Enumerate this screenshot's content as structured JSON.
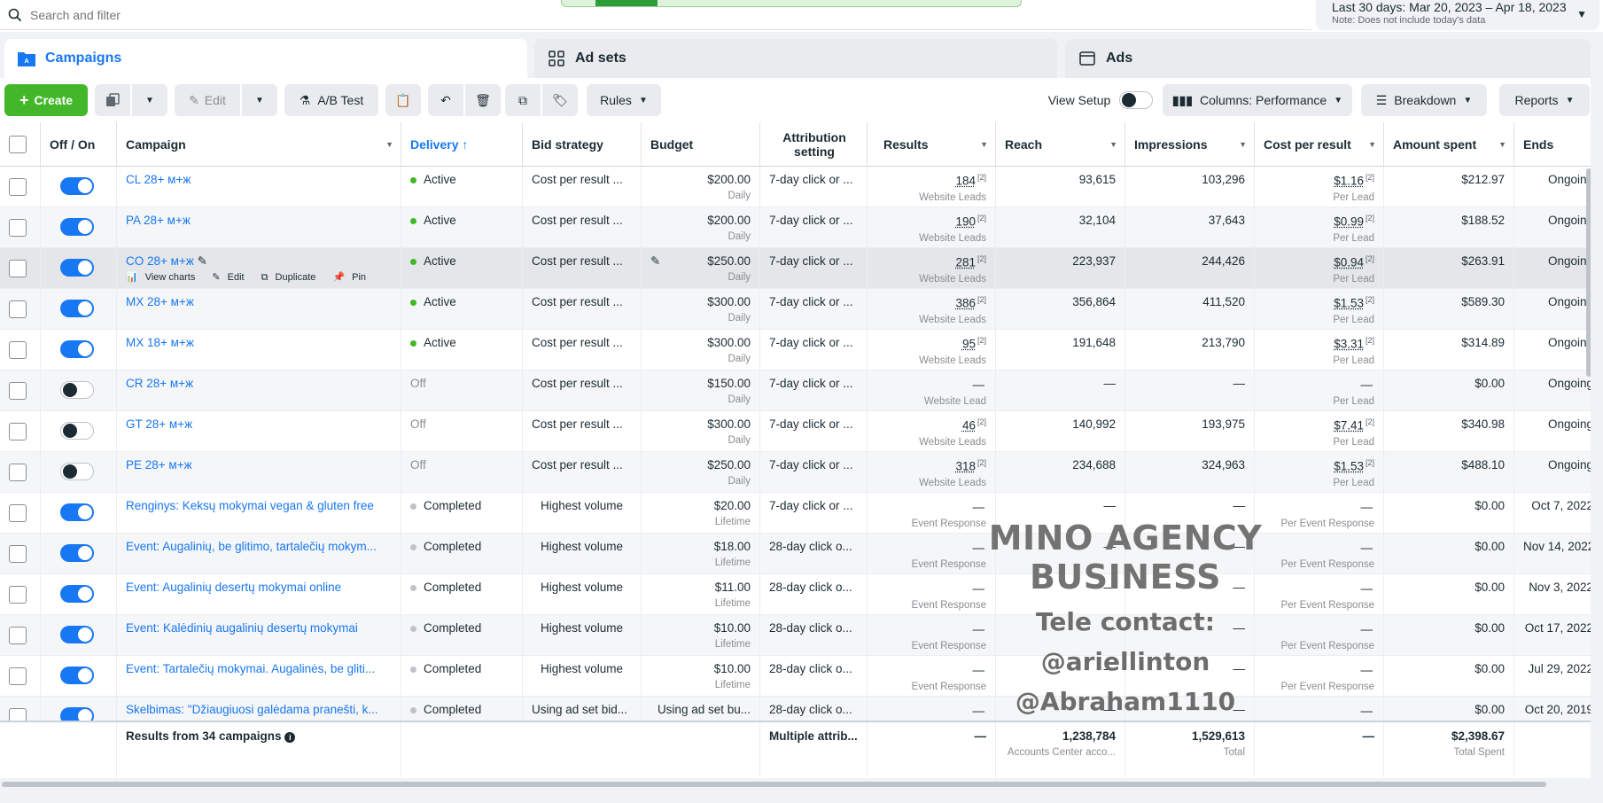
{
  "search": {
    "placeholder": "Search and filter"
  },
  "date_range": {
    "label": "Last 30 days: Mar 20, 2023 – Apr 18, 2023",
    "note": "Note: Does not include today's data"
  },
  "tabs": [
    {
      "label": "Campaigns",
      "icon": "folder-icon",
      "active": true
    },
    {
      "label": "Ad sets",
      "icon": "grid-icon",
      "active": false
    },
    {
      "label": "Ads",
      "icon": "ad-icon",
      "active": false
    }
  ],
  "toolbar": {
    "create": "Create",
    "edit": "Edit",
    "ab_test": "A/B Test",
    "rules": "Rules",
    "view_setup": "View Setup",
    "columns": "Columns: Performance",
    "breakdown": "Breakdown",
    "reports": "Reports"
  },
  "columns": [
    "Off / On",
    "Campaign",
    "Delivery ↑",
    "Bid strategy",
    "Budget",
    "Attribution setting",
    "Results",
    "Reach",
    "Impressions",
    "Cost per result",
    "Amount spent",
    "Ends"
  ],
  "hover_actions": {
    "view_charts": "View charts",
    "edit": "Edit",
    "duplicate": "Duplicate",
    "pin": "Pin"
  },
  "rows": [
    {
      "on": true,
      "campaign": "CL 28+ м+ж",
      "delivery": "Active",
      "status": "active",
      "bid": "Cost per result ...",
      "budget": "$200.00",
      "budget_type": "Daily",
      "attribution": "7-day click or ...",
      "results": "184",
      "results_badge": "[2]",
      "results_sub": "Website Leads",
      "reach": "93,615",
      "impressions": "103,296",
      "cpr": "$1.16",
      "cpr_badge": "[2]",
      "cpr_sub": "Per Lead",
      "spent": "$212.97",
      "ends": "Ongoing"
    },
    {
      "on": true,
      "campaign": "PA 28+ м+ж",
      "delivery": "Active",
      "status": "active",
      "bid": "Cost per result ...",
      "budget": "$200.00",
      "budget_type": "Daily",
      "attribution": "7-day click or ...",
      "results": "190",
      "results_badge": "[2]",
      "results_sub": "Website Leads",
      "reach": "32,104",
      "impressions": "37,643",
      "cpr": "$0.99",
      "cpr_badge": "[2]",
      "cpr_sub": "Per Lead",
      "spent": "$188.52",
      "ends": "Ongoing"
    },
    {
      "on": true,
      "campaign": "CO 28+ м+ж",
      "delivery": "Active",
      "status": "active",
      "bid": "Cost per result ...",
      "budget": "$250.00",
      "budget_type": "Daily",
      "attribution": "7-day click or ...",
      "results": "281",
      "results_badge": "[2]",
      "results_sub": "Website Leads",
      "reach": "223,937",
      "impressions": "244,426",
      "cpr": "$0.94",
      "cpr_badge": "[2]",
      "cpr_sub": "Per Lead",
      "spent": "$263.91",
      "ends": "Ongoing",
      "hover": true
    },
    {
      "on": true,
      "campaign": "MX 28+ м+ж",
      "delivery": "Active",
      "status": "active",
      "bid": "Cost per result ...",
      "budget": "$300.00",
      "budget_type": "Daily",
      "attribution": "7-day click or ...",
      "results": "386",
      "results_badge": "[2]",
      "results_sub": "Website Leads",
      "reach": "356,864",
      "impressions": "411,520",
      "cpr": "$1.53",
      "cpr_badge": "[2]",
      "cpr_sub": "Per Lead",
      "spent": "$589.30",
      "ends": "Ongoing"
    },
    {
      "on": true,
      "campaign": "MX 18+ м+ж",
      "delivery": "Active",
      "status": "active",
      "bid": "Cost per result ...",
      "budget": "$300.00",
      "budget_type": "Daily",
      "attribution": "7-day click or ...",
      "results": "95",
      "results_badge": "[2]",
      "results_sub": "Website Leads",
      "reach": "191,648",
      "impressions": "213,790",
      "cpr": "$3.31",
      "cpr_badge": "[2]",
      "cpr_sub": "Per Lead",
      "spent": "$314.89",
      "ends": "Ongoing"
    },
    {
      "on": false,
      "campaign": "CR 28+ м+ж",
      "delivery": "Off",
      "status": "off",
      "bid": "Cost per result ...",
      "budget": "$150.00",
      "budget_type": "Daily",
      "attribution": "7-day click or ...",
      "results": "—",
      "results_badge": "",
      "results_sub": "Website Lead",
      "reach": "—",
      "impressions": "—",
      "cpr": "—",
      "cpr_badge": "",
      "cpr_sub": "Per Lead",
      "spent": "$0.00",
      "ends": "Ongoing"
    },
    {
      "on": false,
      "campaign": "GT 28+ м+ж",
      "delivery": "Off",
      "status": "off",
      "bid": "Cost per result ...",
      "budget": "$300.00",
      "budget_type": "Daily",
      "attribution": "7-day click or ...",
      "results": "46",
      "results_badge": "[2]",
      "results_sub": "Website Leads",
      "reach": "140,992",
      "impressions": "193,975",
      "cpr": "$7.41",
      "cpr_badge": "[2]",
      "cpr_sub": "Per Lead",
      "spent": "$340.98",
      "ends": "Ongoing"
    },
    {
      "on": false,
      "campaign": "PE 28+ м+ж",
      "delivery": "Off",
      "status": "off",
      "bid": "Cost per result ...",
      "budget": "$250.00",
      "budget_type": "Daily",
      "attribution": "7-day click or ...",
      "results": "318",
      "results_badge": "[2]",
      "results_sub": "Website Leads",
      "reach": "234,688",
      "impressions": "324,963",
      "cpr": "$1.53",
      "cpr_badge": "[2]",
      "cpr_sub": "Per Lead",
      "spent": "$488.10",
      "ends": "Ongoing"
    },
    {
      "on": true,
      "campaign": "Renginys: Keksų mokymai vegan & gluten free",
      "delivery": "Completed",
      "status": "completed",
      "bid": "Highest volume",
      "budget": "$20.00",
      "budget_type": "Lifetime",
      "attribution": "7-day click or ...",
      "results": "—",
      "results_badge": "",
      "results_sub": "Event Response",
      "reach": "—",
      "impressions": "—",
      "cpr": "—",
      "cpr_badge": "",
      "cpr_sub": "Per Event Response",
      "spent": "$0.00",
      "ends": "Oct 7, 2022"
    },
    {
      "on": true,
      "campaign": "Event: Augalinių, be glitimo, tartalečių mokym...",
      "delivery": "Completed",
      "status": "completed",
      "bid": "Highest volume",
      "budget": "$18.00",
      "budget_type": "Lifetime",
      "attribution": "28-day click o...",
      "results": "—",
      "results_badge": "",
      "results_sub": "Event Response",
      "reach": "—",
      "impressions": "—",
      "cpr": "—",
      "cpr_badge": "",
      "cpr_sub": "Per Event Response",
      "spent": "$0.00",
      "ends": "Nov 14, 2022"
    },
    {
      "on": true,
      "campaign": "Event: Augalinių desertų mokymai online",
      "delivery": "Completed",
      "status": "completed",
      "bid": "Highest volume",
      "budget": "$11.00",
      "budget_type": "Lifetime",
      "attribution": "28-day click o...",
      "results": "—",
      "results_badge": "",
      "results_sub": "Event Response",
      "reach": "—",
      "impressions": "—",
      "cpr": "—",
      "cpr_badge": "",
      "cpr_sub": "Per Event Response",
      "spent": "$0.00",
      "ends": "Nov 3, 2022"
    },
    {
      "on": true,
      "campaign": "Event: Kalėdinių augalinių desertų mokymai",
      "delivery": "Completed",
      "status": "completed",
      "bid": "Highest volume",
      "budget": "$10.00",
      "budget_type": "Lifetime",
      "attribution": "28-day click o...",
      "results": "—",
      "results_badge": "",
      "results_sub": "Event Response",
      "reach": "—",
      "impressions": "—",
      "cpr": "—",
      "cpr_badge": "",
      "cpr_sub": "Per Event Response",
      "spent": "$0.00",
      "ends": "Oct 17, 2022"
    },
    {
      "on": true,
      "campaign": "Event: Tartalečių mokymai. Augalinės, be gliti...",
      "delivery": "Completed",
      "status": "completed",
      "bid": "Highest volume",
      "budget": "$10.00",
      "budget_type": "Lifetime",
      "attribution": "28-day click o...",
      "results": "—",
      "results_badge": "",
      "results_sub": "Event Response",
      "reach": "—",
      "impressions": "—",
      "cpr": "—",
      "cpr_badge": "",
      "cpr_sub": "Per Event Response",
      "spent": "$0.00",
      "ends": "Jul 29, 2022"
    },
    {
      "on": true,
      "campaign": "Skelbimas: \"Džiaugiuosi galėdama pranešti, k...",
      "delivery": "Completed",
      "status": "completed",
      "bid": "Using ad set bid...",
      "budget": "Using ad set bu...",
      "budget_type": "",
      "attribution": "28-day click o...",
      "results": "—",
      "results_badge": "",
      "results_sub": "",
      "reach": "—",
      "impressions": "—",
      "cpr": "—",
      "cpr_badge": "",
      "cpr_sub": "",
      "spent": "$0.00",
      "ends": "Oct 20, 2019"
    }
  ],
  "footer": {
    "label": "Results from 34 campaigns",
    "attribution": "Multiple attrib...",
    "results": "—",
    "reach": "1,238,784",
    "reach_sub": "Accounts Center acco...",
    "impressions": "1,529,613",
    "impressions_sub": "Total",
    "cpr": "—",
    "spent": "$2,398.67",
    "spent_sub": "Total Spent"
  },
  "watermark": {
    "title": "MINO AGENCY BUSINESS",
    "line1": "Tele contact:",
    "line2": "@ariellinton",
    "line3": "@Abraham1110"
  },
  "colors": {
    "accent": "#1877f2",
    "create": "#42b72a",
    "active_dot": "#42b72a"
  }
}
